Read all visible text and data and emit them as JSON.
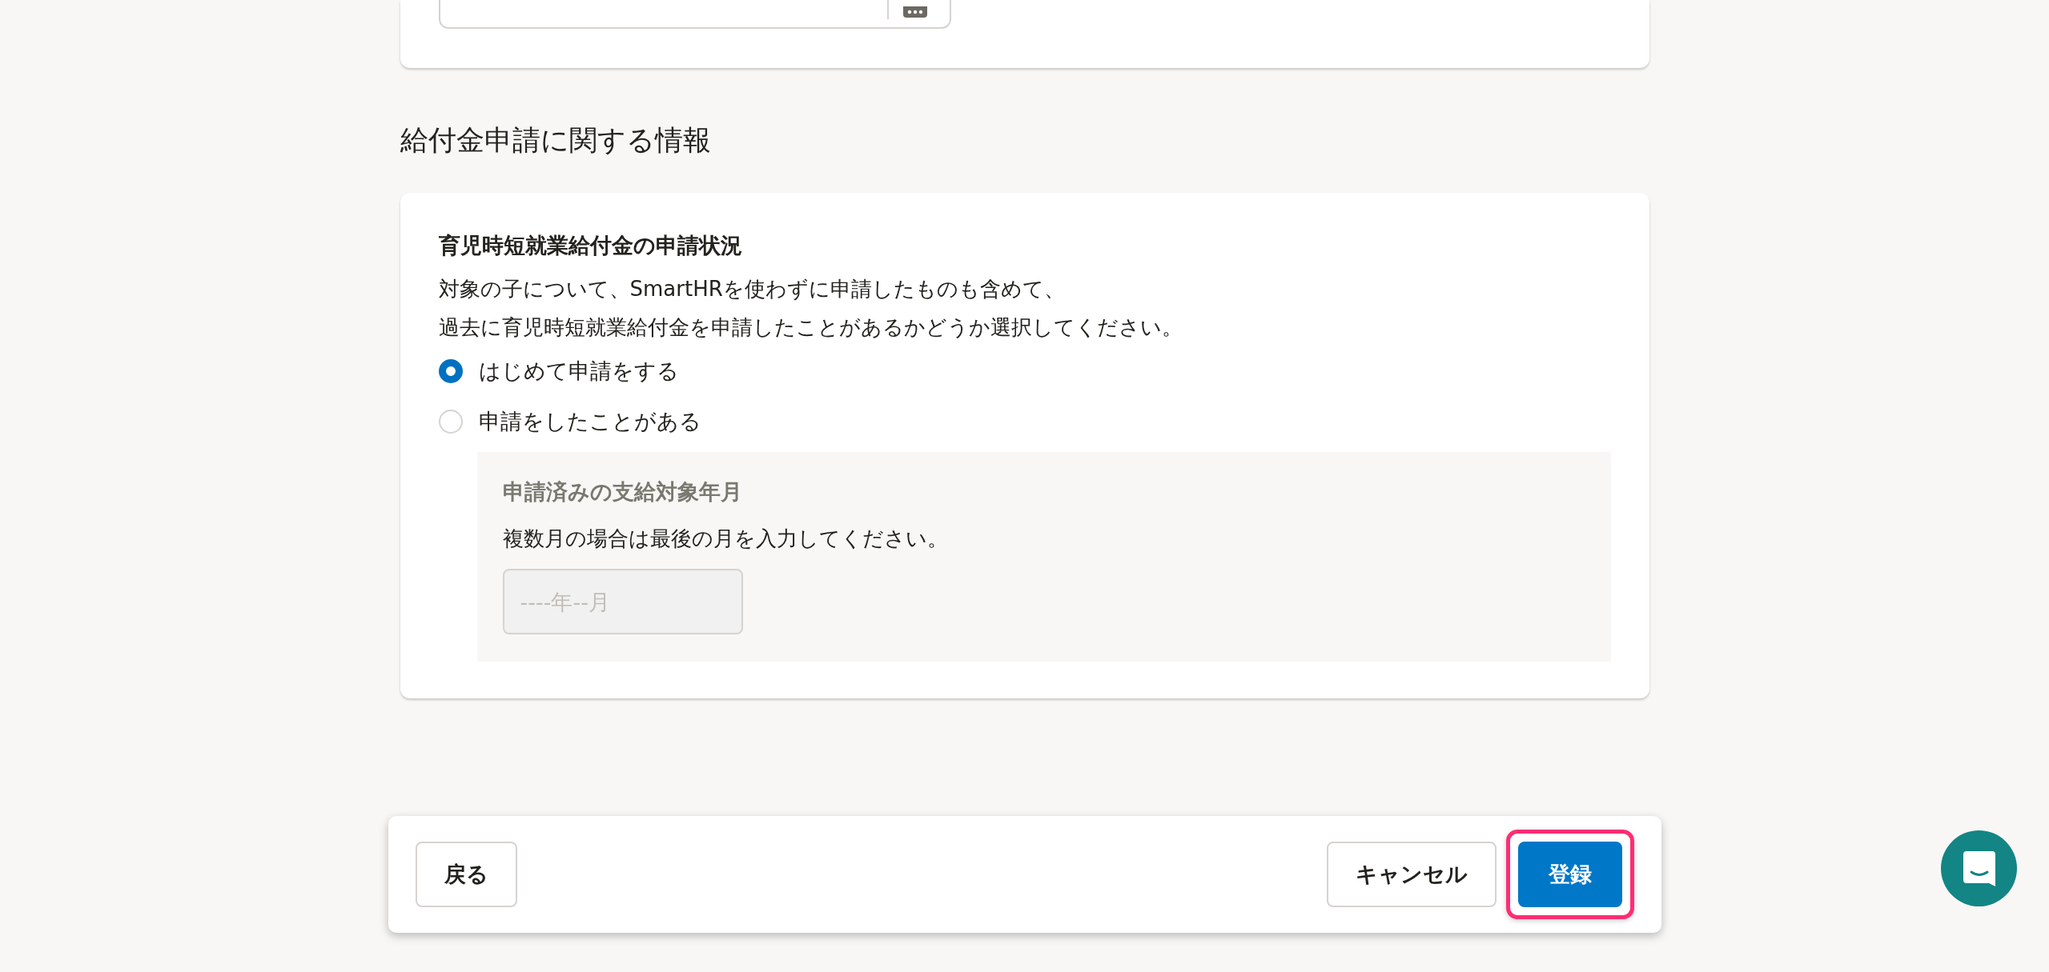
{
  "section_title": "給付金申請に関する情報",
  "application_status": {
    "label": "育児時短就業給付金の申請状況",
    "description": [
      "対象の子について、SmartHRを使わずに申請したものも含めて、",
      "過去に育児時短就業給付金を申請したことがあるかどうか選択してください。"
    ],
    "options": [
      {
        "label": "はじめて申請をする",
        "selected": true
      },
      {
        "label": "申請をしたことがある",
        "selected": false
      }
    ],
    "previous_month": {
      "label": "申請済みの支給対象年月",
      "hint": "複数月の場合は最後の月を入力してください。",
      "placeholder": "----年--月",
      "disabled": true
    }
  },
  "footer": {
    "back_button": "戻る",
    "cancel_button": "キャンセル",
    "submit_button": {
      "label": "登録",
      "highlighted": true
    }
  }
}
